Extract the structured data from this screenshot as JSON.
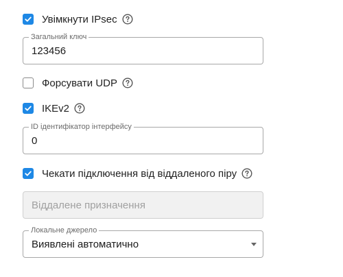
{
  "enable_ipsec": {
    "label": "Увімкнути IPsec",
    "checked": true
  },
  "shared_key": {
    "legend": "Загальний ключ",
    "value": "123456"
  },
  "force_udp": {
    "label": "Форсувати UDP",
    "checked": false
  },
  "ikev2": {
    "label": "IKEv2",
    "checked": true
  },
  "interface_id": {
    "legend": "ID ідентифікатор інтерфейсу",
    "value": "0"
  },
  "wait_peer": {
    "label": "Чекати підключення від віддаленого піру",
    "checked": true
  },
  "remote_destination": {
    "placeholder": "Віддалене призначення"
  },
  "local_source": {
    "legend": "Локальне джерело",
    "value": "Виявлені автоматично"
  },
  "colors": {
    "accent": "#1e88e5",
    "border": "#a7a7a7",
    "disabled_bg": "#f1f1f1"
  }
}
